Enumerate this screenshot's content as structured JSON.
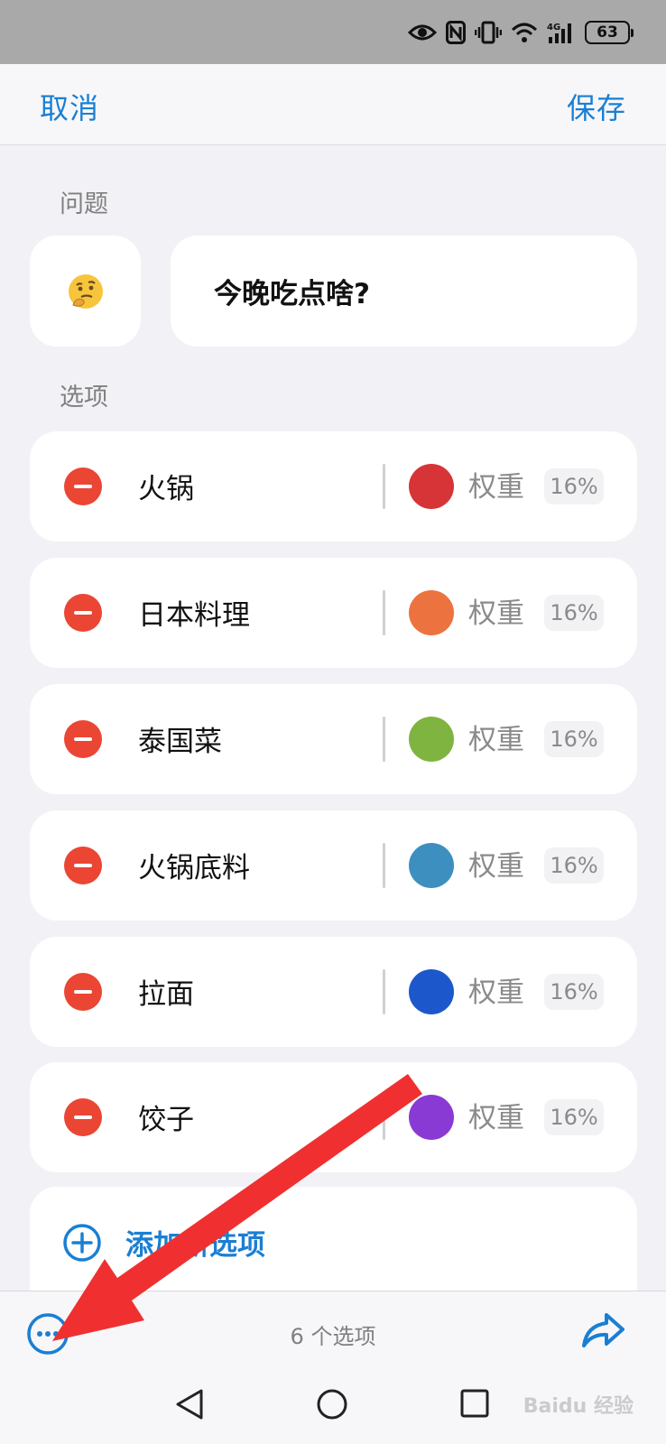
{
  "status_bar": {
    "battery": "63"
  },
  "nav": {
    "cancel_label": "取消",
    "save_label": "保存"
  },
  "question": {
    "section_label": "问题",
    "emoji": "🤔",
    "text": "今晚吃点啥?"
  },
  "options": {
    "section_label": "选项",
    "weight_label": "权重",
    "items": [
      {
        "label": "火锅",
        "color": "#d63437",
        "weight": "16%"
      },
      {
        "label": "日本料理",
        "color": "#ec7340",
        "weight": "16%"
      },
      {
        "label": "泰国菜",
        "color": "#7fb440",
        "weight": "16%"
      },
      {
        "label": "火锅底料",
        "color": "#3d8fc0",
        "weight": "16%"
      },
      {
        "label": "拉面",
        "color": "#1d57cc",
        "weight": "16%"
      },
      {
        "label": "饺子",
        "color": "#8a3ad4",
        "weight": "16%"
      }
    ],
    "add_label": "添加新选项"
  },
  "bottom_bar": {
    "count_label": "6 个选项"
  },
  "watermark": "Baidu 经验",
  "colors": {
    "accent": "#1a7fd3",
    "remove": "#eb4534",
    "annotation_arrow": "#f03030"
  }
}
